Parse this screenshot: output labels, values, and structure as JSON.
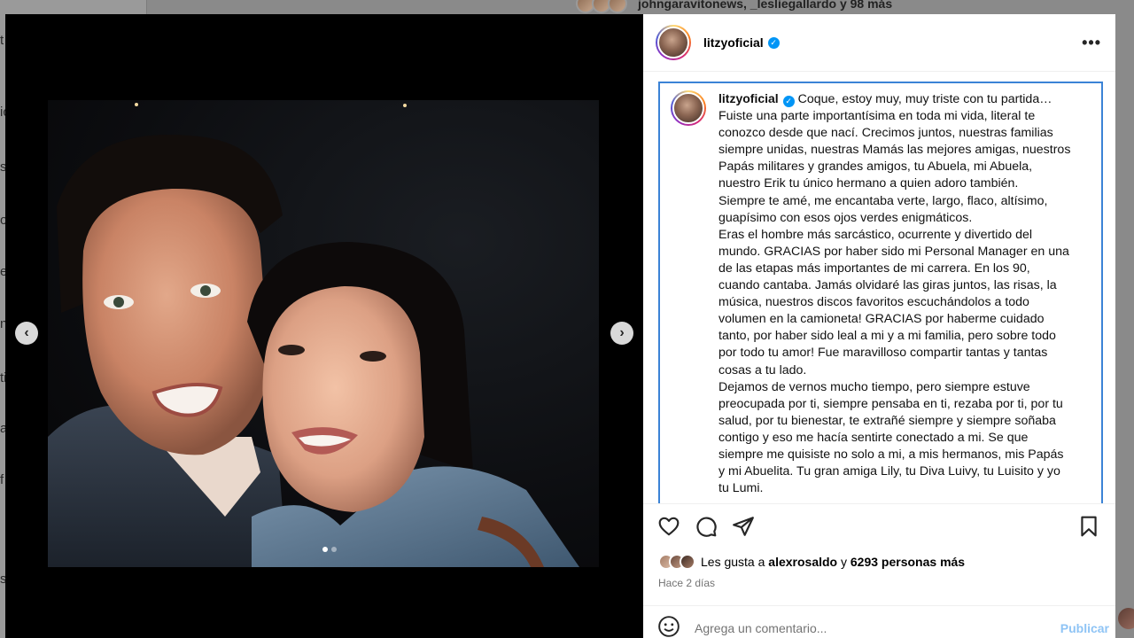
{
  "background": {
    "top_text": "johngaravitonews, _lesliegallardo y 98 más",
    "left_peek_letters": [
      "t",
      "ic",
      "so",
      "ol",
      "el",
      "n",
      "ti",
      "a",
      "f",
      "s"
    ]
  },
  "post": {
    "username": "litzyoficial",
    "verified": true,
    "more_icon": "ellipsis-icon",
    "media": {
      "prev_icon": "chevron-left-icon",
      "next_icon": "chevron-right-icon",
      "carousel_count": 2,
      "carousel_active": 1
    },
    "caption": {
      "username": "litzyoficial",
      "first_line": "Coque, estoy muy, muy triste con tu partida…",
      "lines": [
        "Fuiste una parte importantísima en toda mi vida, literal te",
        "conozco desde que nací. Crecimos juntos, nuestras familias",
        "siempre unidas, nuestras Mamás las mejores amigas, nuestros",
        "Papás militares y grandes amigos, tu Abuela, mi Abuela,",
        "nuestro Erik tu único hermano a quien adoro también.",
        "Siempre te amé, me encantaba verte, largo, flaco, altísimo,",
        "guapísimo con esos ojos verdes enigmáticos.",
        "Eras el hombre más sarcástico, ocurrente y divertido del",
        "mundo. GRACIAS por haber sido mi Personal Manager en una",
        "de las etapas más importantes de mi carrera. En los 90,",
        "cuando cantaba. Jamás olvidaré las giras juntos, las risas, la",
        "música, nuestros discos favoritos escuchándolos a todo",
        "volumen en la camioneta! GRACIAS por haberme cuidado",
        "tanto, por haber sido leal a mi y a mi familia, pero sobre todo",
        "por todo tu amor! Fue maravilloso compartir tantas y tantas",
        "cosas a tu lado.",
        "Dejamos de vernos mucho tiempo, pero siempre estuve",
        "preocupada por ti, siempre pensaba en ti, rezaba por ti, por tu",
        "salud, por tu bienestar, te extrañé siempre y siempre soñaba",
        "contigo y eso me hacía sentirte conectado a mi. Se que",
        "siempre me quisiste no solo a mi, a mis hermanos, mis Papás",
        "y mi Abuelita. Tu gran amiga Lily, tu Diva Luivy, tu Luisito y yo",
        "tu Lumi."
      ]
    },
    "actions": {
      "like_icon": "heart-icon",
      "comment_icon": "comment-icon",
      "share_icon": "share-icon",
      "save_icon": "bookmark-icon"
    },
    "likes": {
      "prefix": "Les gusta a ",
      "user": "alexrosaldo",
      "middle": " y ",
      "others": "6293 personas más"
    },
    "time_ago": "Hace 2 días",
    "comment": {
      "placeholder": "Agrega un comentario...",
      "emoji_icon": "emoji-icon",
      "publish_label": "Publicar"
    }
  }
}
